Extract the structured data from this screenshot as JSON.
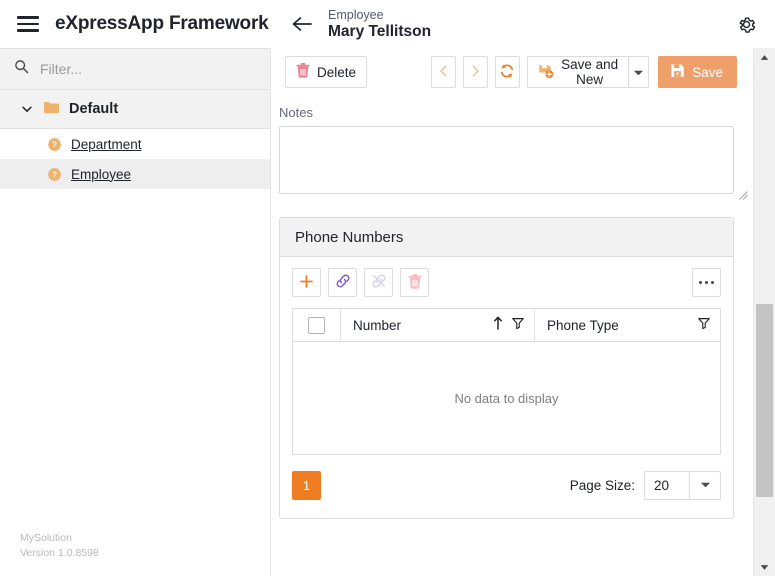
{
  "app": {
    "brand": "eXpressApp Framework",
    "menu_icon": "hamburger-icon"
  },
  "header": {
    "back_icon": "back-arrow-icon",
    "subtitle": "Employee",
    "title": "Mary Tellitson",
    "settings_icon": "gear-icon"
  },
  "sidebar": {
    "filter": {
      "value": "",
      "placeholder": "Filter...",
      "icon": "search-icon"
    },
    "group": {
      "label": "Default",
      "expanded": true,
      "icon": "folder-icon",
      "chevron": "chevron-down-icon"
    },
    "items": [
      {
        "label": "Department",
        "icon": "question-badge-icon",
        "selected": false
      },
      {
        "label": "Employee",
        "icon": "question-badge-icon",
        "selected": true
      }
    ],
    "footer": {
      "solution": "MySolution",
      "version": "Version 1.0.8598"
    }
  },
  "toolbar": {
    "delete_label": "Delete",
    "delete_icon": "trash-icon",
    "prev_icon": "chevron-left-icon",
    "next_icon": "chevron-right-icon",
    "refresh_icon": "refresh-icon",
    "save_and_new_label": "Save and New",
    "save_and_new_icon": "save-new-icon",
    "split_arrow_icon": "caret-down-icon",
    "save_label": "Save",
    "save_icon": "floppy-icon"
  },
  "form": {
    "notes_label": "Notes",
    "notes_value": "",
    "notes_placeholder": ""
  },
  "panel": {
    "title": "Phone Numbers",
    "actions": {
      "add_icon": "plus-icon",
      "link_icon": "link-icon",
      "unlink_icon": "unlink-icon",
      "delete_icon": "trash-icon",
      "more_icon": "ellipsis-icon"
    },
    "grid": {
      "select_all_checked": false,
      "columns": [
        {
          "label": "Number",
          "sort_icon": "sort-asc-icon",
          "filter_icon": "filter-icon"
        },
        {
          "label": "Phone Type",
          "filter_icon": "filter-icon"
        }
      ],
      "rows": [],
      "empty_text": "No data to display"
    },
    "pager": {
      "current_page": "1",
      "page_size_label": "Page Size:",
      "page_size_value": "20",
      "page_size_arrow_icon": "caret-down-icon"
    }
  },
  "scrollbar": {
    "up_icon": "caret-up-icon",
    "down_icon": "caret-down-icon"
  },
  "colors": {
    "accent_orange": "#ef7d22",
    "save_orange": "#efa06a",
    "link_purple": "#7b5ec7",
    "delete_pink": "#e9818f"
  }
}
